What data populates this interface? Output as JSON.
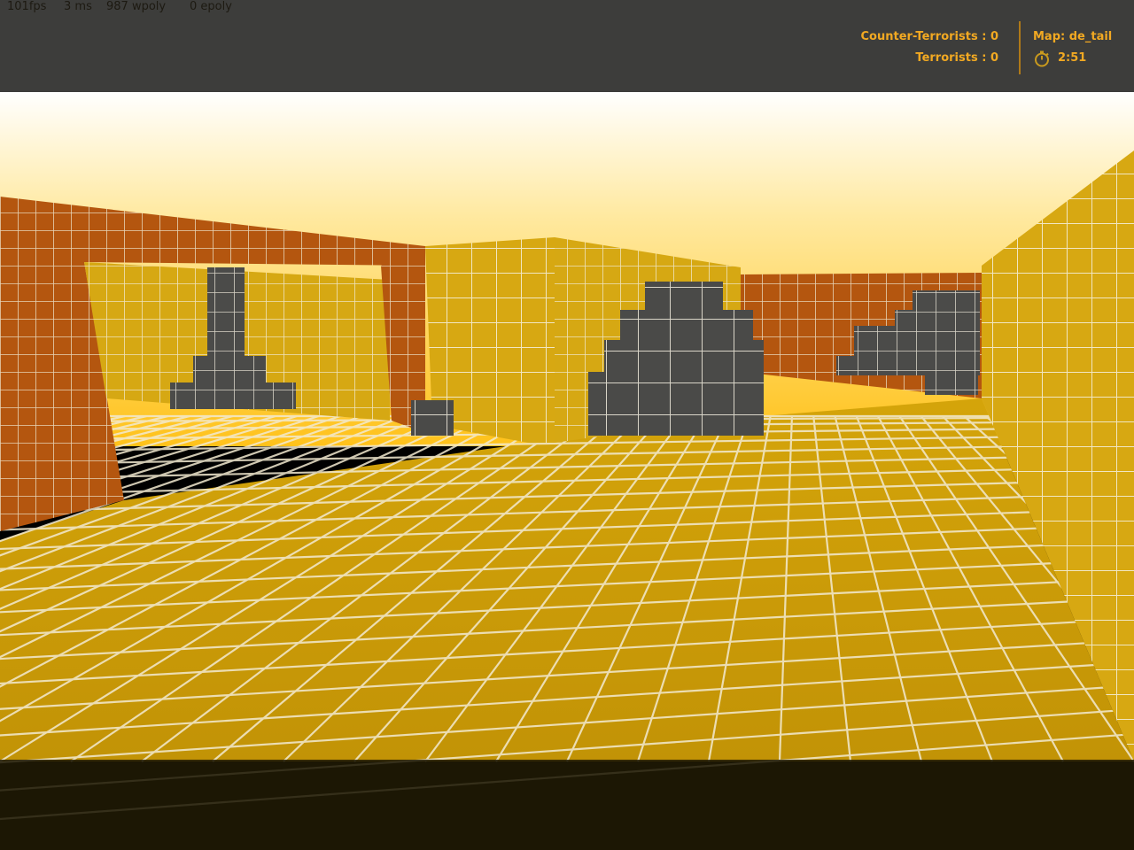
{
  "hud": {
    "fps": "101fps",
    "ms": "3 ms",
    "wpoly": "987 wpoly",
    "epoly": "0 epoly",
    "ct_score": "Counter-Terrorists : 0",
    "t_score": "Terrorists : 0",
    "map": "Map: de_tail",
    "timer": "2:51",
    "timer_icon": "stopwatch-icon"
  },
  "colors": {
    "hud_text": "#f2a922",
    "hud_bar": "#3d3d3b",
    "floor_tile": "#c89a06",
    "orange_tile": "#b8560e",
    "crate": "#4a4a48",
    "sky_top": "#ffffff",
    "sky_bottom": "#ffc21a"
  }
}
